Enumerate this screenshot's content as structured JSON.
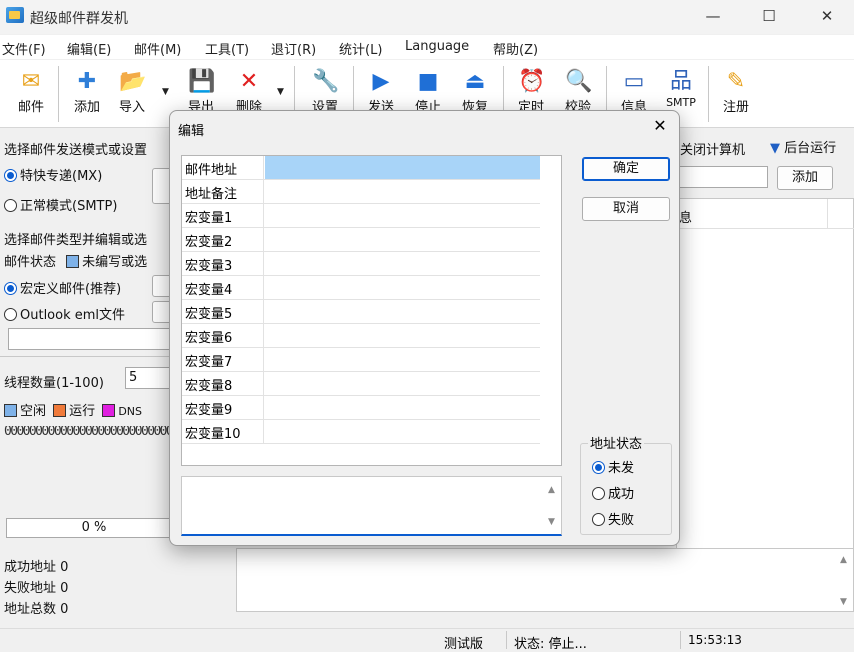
{
  "window": {
    "title": "超级邮件群发机",
    "minimize": "—",
    "maximize": "☐",
    "close": "✕"
  },
  "menu": [
    "文件(F)",
    "编辑(E)",
    "邮件(M)",
    "工具(T)",
    "退订(R)",
    "统计(L)",
    "Language",
    "帮助(Z)"
  ],
  "toolbar": [
    {
      "label": "邮件",
      "icon": "envelope-icon",
      "glyph": "✉",
      "color": "#e8a11a"
    },
    {
      "label": "添加",
      "icon": "plus-icon",
      "glyph": "✚",
      "color": "#2f7fd8"
    },
    {
      "label": "导入",
      "icon": "folder-import-icon",
      "glyph": "📂",
      "color": "#e8b52c"
    },
    {
      "label": "导出",
      "icon": "save-icon",
      "glyph": "💾",
      "color": "#2f62b8"
    },
    {
      "label": "删除",
      "icon": "delete-x-icon",
      "glyph": "✕",
      "color": "#e02020"
    },
    {
      "label": "设置",
      "icon": "wrench-icon",
      "glyph": "🔧",
      "color": "#c0392b"
    },
    {
      "label": "发送",
      "icon": "play-icon",
      "glyph": "▶",
      "color": "#1f6fd6"
    },
    {
      "label": "停止",
      "icon": "stop-icon",
      "glyph": "■",
      "color": "#1f6fd6"
    },
    {
      "label": "恢复",
      "icon": "eject-icon",
      "glyph": "⏏",
      "color": "#1f6fd6"
    },
    {
      "label": "定时",
      "icon": "alarm-clock-icon",
      "glyph": "⏰",
      "color": "#e03a1e"
    },
    {
      "label": "校验",
      "icon": "magnifier-icon",
      "glyph": "🔍",
      "color": "#3a7ec8"
    },
    {
      "label": "信息",
      "icon": "window-icon",
      "glyph": "▭",
      "color": "#2f62b8"
    },
    {
      "label": "SMTP",
      "icon": "network-icon",
      "glyph": "品",
      "color": "#2f62b8"
    },
    {
      "label": "注册",
      "icon": "register-icon",
      "glyph": "✎",
      "color": "#e8a11a"
    }
  ],
  "left": {
    "mode_heading": "选择邮件发送模式或设置",
    "mode_express": "特快专递(MX)",
    "mode_normal": "正常模式(SMTP)",
    "type_heading": "选择邮件类型并编辑或选",
    "status_label": "邮件状态",
    "status_unwritten": "未编写或选",
    "type_macro": "宏定义邮件(推荐)",
    "type_eml": "Outlook eml文件",
    "threads_label": "线程数量(1-100)",
    "threads_value": "5",
    "legend_idle": "空闲",
    "legend_running": "运行",
    "legend_dns": "DNS",
    "dots": "00000000000000000000000000000000000000000000000000000000000000000000000000000000000000000000000000000",
    "progress": "0 %",
    "success_label": "成功地址",
    "success_value": "0",
    "fail_label": "失败地址",
    "fail_value": "0",
    "total_label": "地址总数",
    "total_value": "0"
  },
  "right": {
    "shutdown": "关闭计算机",
    "background": "后台运行",
    "add_button": "添加",
    "col_info": "息"
  },
  "statusbar": {
    "edition": "测试版",
    "status": "状态: 停止...",
    "time": "15:53:13"
  },
  "dialog": {
    "title": "编辑",
    "close": "✕",
    "ok": "确定",
    "cancel": "取消",
    "fields": [
      "邮件地址",
      "地址备注",
      "宏变量1",
      "宏变量2",
      "宏变量3",
      "宏变量4",
      "宏变量5",
      "宏变量6",
      "宏变量7",
      "宏变量8",
      "宏变量9",
      "宏变量10"
    ],
    "addr_status": "地址状态",
    "status_unsent": "未发",
    "status_success": "成功",
    "status_fail": "失败"
  },
  "colors": {
    "idle": "#7fb2e8",
    "running": "#f07a3a",
    "dns": "#e020e0",
    "accent": "#0a5cd0",
    "selected_cell": "#a8d4f8"
  }
}
